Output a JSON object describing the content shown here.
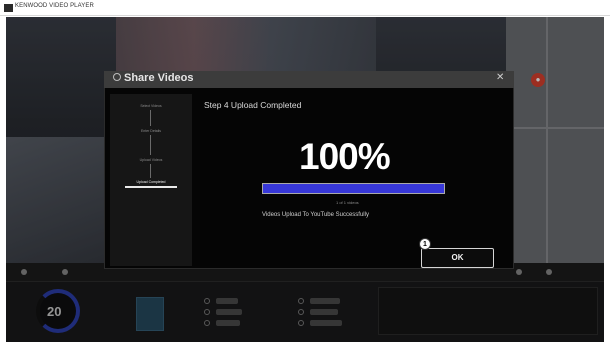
{
  "window": {
    "title": "KENWOOD VIDEO PLAYER"
  },
  "background": {
    "speed": "20",
    "map_pin_icon": "map-pin-icon"
  },
  "dialog": {
    "title": "Share Videos",
    "close_glyph": "✕",
    "steps": [
      {
        "label": "Select Videos",
        "active": false
      },
      {
        "label": "Enter Details",
        "active": false
      },
      {
        "label": "Upload Videos",
        "active": false
      },
      {
        "label": "Upload Completed",
        "active": true
      }
    ],
    "heading": "Step 4 Upload Completed",
    "percent": "100%",
    "progress": 1.0,
    "status_small": "1 of 1 videos",
    "success_message": "Videos Upload To YouTube Successfully",
    "ok_label": "OK"
  },
  "callout": {
    "number": "1"
  },
  "colors": {
    "progress": "#3838d9",
    "accent_red": "#d8412f",
    "gauge": "#2b3ea8"
  }
}
